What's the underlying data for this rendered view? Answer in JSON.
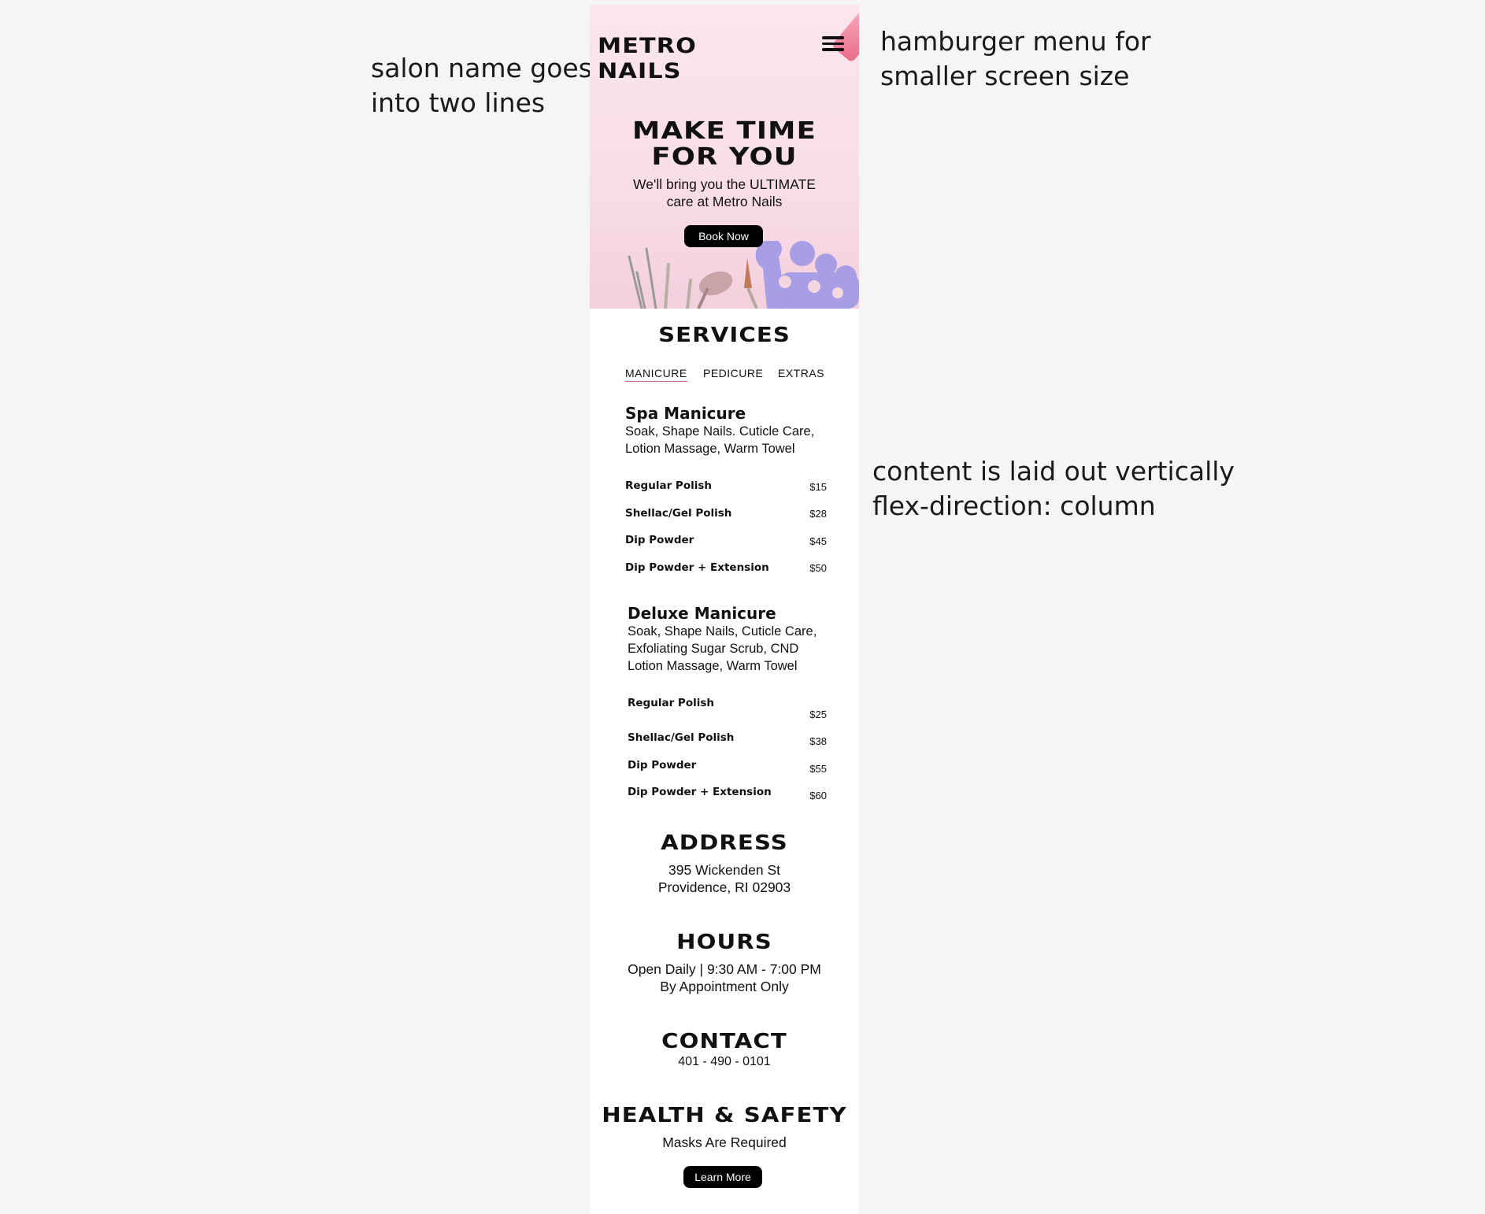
{
  "annotations": {
    "salon_name": [
      "salon name goes",
      "into two lines"
    ],
    "hamburger": [
      "hamburger menu for",
      "smaller screen size"
    ],
    "layout": [
      "content is laid out vertically",
      "flex-direction: column"
    ]
  },
  "header": {
    "logo_lines": [
      "METRO",
      "NAILS"
    ],
    "menu_icon": "hamburger-icon"
  },
  "hero": {
    "title_lines": [
      "MAKE TIME",
      "FOR YOU"
    ],
    "subtitle_lines": [
      "We'll bring you the ULTIMATE",
      "care at Metro Nails"
    ],
    "cta": "Book Now"
  },
  "services": {
    "title": "SERVICES",
    "tabs": [
      {
        "label": "MANICURE",
        "active": true
      },
      {
        "label": "PEDICURE",
        "active": false
      },
      {
        "label": "EXTRAS",
        "active": false
      }
    ],
    "items": [
      {
        "name": "Spa Manicure",
        "desc_lines": [
          "Soak, Shape Nails. Cuticle Care,",
          "Lotion Massage, Warm Towel"
        ],
        "prices": [
          {
            "name": "Regular Polish",
            "price": "$15"
          },
          {
            "name": "Shellac/Gel Polish",
            "price": "$28"
          },
          {
            "name": "Dip Powder",
            "price": "$45"
          },
          {
            "name": "Dip Powder + Extension",
            "price": "$50"
          }
        ]
      },
      {
        "name": "Deluxe Manicure",
        "desc_lines": [
          "Soak, Shape Nails, Cuticle Care,",
          "Exfoliating Sugar Scrub, CND",
          "Lotion Massage, Warm Towel"
        ],
        "prices": [
          {
            "name": "Regular Polish",
            "price": "$25"
          },
          {
            "name": "Shellac/Gel Polish",
            "price": "$38"
          },
          {
            "name": "Dip Powder",
            "price": "$55"
          },
          {
            "name": "Dip Powder + Extension",
            "price": "$60"
          }
        ]
      }
    ]
  },
  "address": {
    "title": "ADDRESS",
    "lines": [
      "395 Wickenden St",
      "Providence, RI 02903"
    ]
  },
  "hours": {
    "title": "HOURS",
    "lines": [
      "Open Daily | 9:30 AM - 7:00 PM",
      "By Appointment Only"
    ]
  },
  "contact": {
    "title": "CONTACT",
    "phone": "401 - 490 - 0101"
  },
  "health": {
    "title": "HEALTH & SAFETY",
    "text": "Masks Are Required",
    "cta": "Learn More"
  },
  "colors": {
    "page_bg": "#f5f5f5",
    "hero_bg": "#f8dde7",
    "accent_underline": "#d36b86",
    "button_bg": "#000000"
  }
}
